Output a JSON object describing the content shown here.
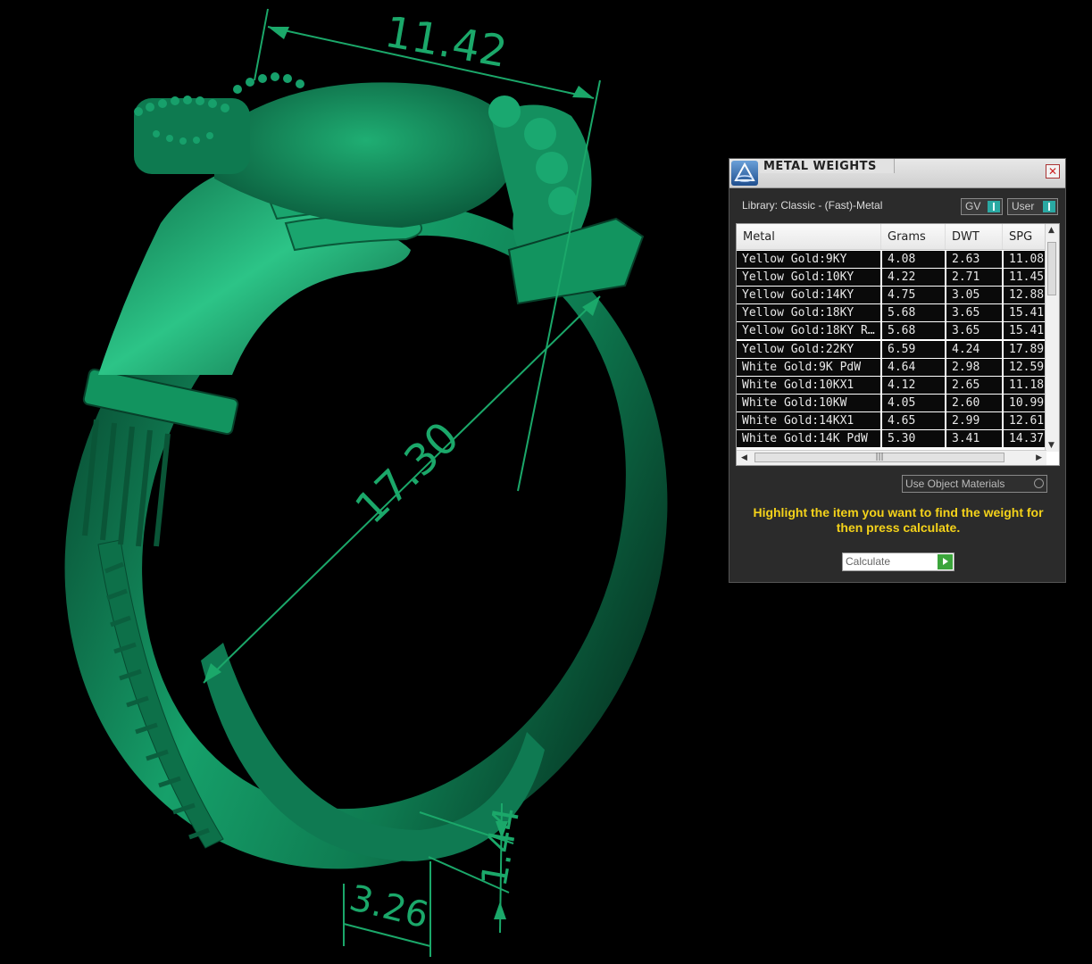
{
  "dimensions": {
    "top_width": "11.42",
    "diameter": "17.30",
    "band_height": "1.44",
    "band_width": "3.26"
  },
  "colors": {
    "ring_green": "#0f7a52",
    "dimension_green": "#1ba86a",
    "hint_yellow": "#f4d21a",
    "toggle_teal": "#2aa9a3",
    "calc_green": "#3ba53b"
  },
  "panel": {
    "title": "METAL WEIGHTS",
    "close_icon": "close-icon",
    "library": "Library: Classic - (Fast)-Metal",
    "toggle_gv": "GV",
    "toggle_user": "User",
    "columns": [
      "Metal",
      "Grams",
      "DWT",
      "SPG"
    ],
    "rows": [
      {
        "metal": "Yellow Gold:9KY",
        "grams": "4.08",
        "dwt": "2.63",
        "spg": "11.08"
      },
      {
        "metal": "Yellow Gold:10KY",
        "grams": "4.22",
        "dwt": "2.71",
        "spg": "11.45"
      },
      {
        "metal": "Yellow Gold:14KY",
        "grams": "4.75",
        "dwt": "3.05",
        "spg": "12.88"
      },
      {
        "metal": "Yellow Gold:18KY",
        "grams": "5.68",
        "dwt": "3.65",
        "spg": "15.41"
      },
      {
        "metal": "Yellow Gold:18KY R…",
        "grams": "5.68",
        "dwt": "3.65",
        "spg": "15.41"
      },
      {
        "metal": "Yellow Gold:22KY",
        "grams": "6.59",
        "dwt": "4.24",
        "spg": "17.89"
      },
      {
        "metal": "White Gold:9K PdW",
        "grams": "4.64",
        "dwt": "2.98",
        "spg": "12.59"
      },
      {
        "metal": "White Gold:10KX1",
        "grams": "4.12",
        "dwt": "2.65",
        "spg": "11.18"
      },
      {
        "metal": "White Gold:10KW",
        "grams": "4.05",
        "dwt": "2.60",
        "spg": "10.99"
      },
      {
        "metal": "White Gold:14KX1",
        "grams": "4.65",
        "dwt": "2.99",
        "spg": "12.61"
      },
      {
        "metal": "White Gold:14K PdW",
        "grams": "5.30",
        "dwt": "3.41",
        "spg": "14.37"
      }
    ],
    "use_object_materials": "Use Object Materials",
    "hint": "Highlight the item you want to find the weight for then press calculate.",
    "calculate": "Calculate"
  }
}
